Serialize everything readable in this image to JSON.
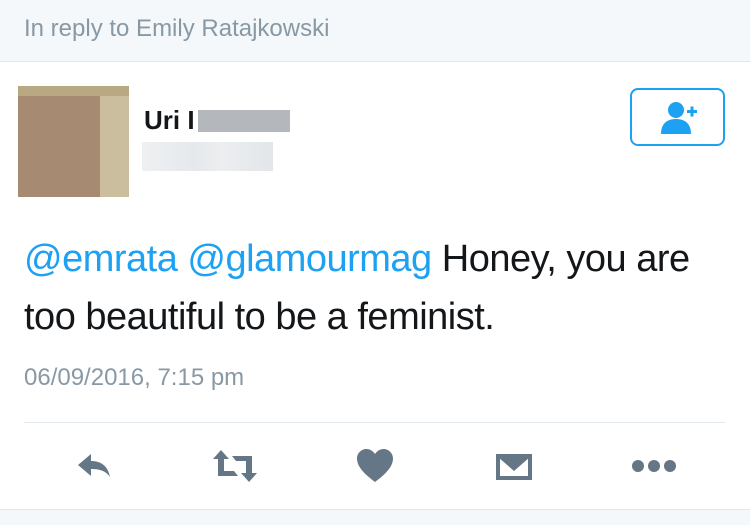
{
  "reply_context": {
    "text": "In reply to Emily Ratajkowski"
  },
  "author": {
    "name_visible": "Uri I",
    "avatar_icon": "user-avatar-photo"
  },
  "follow_button": {
    "icon": "add-user-icon",
    "color": "#1da1f2"
  },
  "tweet": {
    "mention_1": "@emrata",
    "mention_2": "@glamourmag",
    "body": "Honey, you are too beautiful to be a feminist.",
    "timestamp": "06/09/2016, 7:15 pm"
  },
  "actions": [
    {
      "name": "reply",
      "icon": "reply-icon"
    },
    {
      "name": "retweet",
      "icon": "retweet-icon"
    },
    {
      "name": "like",
      "icon": "heart-icon"
    },
    {
      "name": "direct-message",
      "icon": "envelope-icon"
    },
    {
      "name": "more",
      "icon": "more-dots-icon"
    }
  ],
  "colors": {
    "link": "#1da1f2",
    "secondary_text": "#8899a6",
    "icon": "#657786",
    "primary_text": "#14171a"
  }
}
